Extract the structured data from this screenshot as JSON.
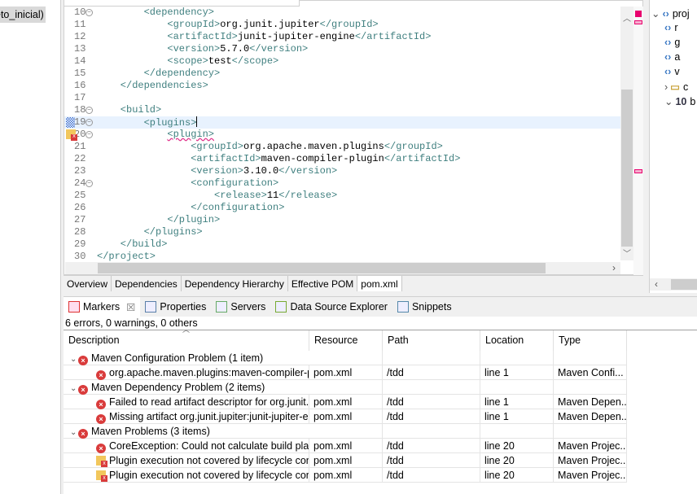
{
  "left_panel": {
    "selected_item": "eto_inicial)"
  },
  "editor": {
    "lines": [
      {
        "n": "10",
        "fold": true,
        "indent": 2,
        "parts": [
          [
            "tag",
            "<dependency>"
          ]
        ]
      },
      {
        "n": "11",
        "indent": 3,
        "parts": [
          [
            "tag",
            "<groupId>"
          ],
          [
            "txt",
            "org.junit.jupiter"
          ],
          [
            "tag",
            "</groupId>"
          ]
        ]
      },
      {
        "n": "12",
        "indent": 3,
        "parts": [
          [
            "tag",
            "<artifactId>"
          ],
          [
            "txt",
            "junit-jupiter-engine"
          ],
          [
            "tag",
            "</artifactId>"
          ]
        ]
      },
      {
        "n": "13",
        "indent": 3,
        "parts": [
          [
            "tag",
            "<version>"
          ],
          [
            "txt",
            "5.7.0"
          ],
          [
            "tag",
            "</version>"
          ]
        ]
      },
      {
        "n": "14",
        "indent": 3,
        "parts": [
          [
            "tag",
            "<scope>"
          ],
          [
            "txt",
            "test"
          ],
          [
            "tag",
            "</scope>"
          ]
        ]
      },
      {
        "n": "15",
        "indent": 2,
        "parts": [
          [
            "tag",
            "</dependency>"
          ]
        ]
      },
      {
        "n": "16",
        "indent": 1,
        "parts": [
          [
            "tag",
            "</dependencies>"
          ]
        ]
      },
      {
        "n": "17",
        "indent": 0,
        "parts": []
      },
      {
        "n": "18",
        "fold": true,
        "indent": 1,
        "parts": [
          [
            "tag",
            "<build>"
          ]
        ]
      },
      {
        "n": "19",
        "fold": true,
        "indent": 2,
        "current": true,
        "parts": [
          [
            "tag",
            "<plugins>"
          ]
        ]
      },
      {
        "n": "20",
        "fold": true,
        "indent": 3,
        "marker": "warning-error",
        "parts": [
          [
            "sq",
            "<plugin>"
          ]
        ]
      },
      {
        "n": "21",
        "indent": 4,
        "parts": [
          [
            "tag",
            "<groupId>"
          ],
          [
            "txt",
            "org.apache.maven.plugins"
          ],
          [
            "tag",
            "</groupId>"
          ]
        ]
      },
      {
        "n": "22",
        "indent": 4,
        "parts": [
          [
            "tag",
            "<artifactId>"
          ],
          [
            "txt",
            "maven-compiler-plugin"
          ],
          [
            "tag",
            "</artifactId>"
          ]
        ]
      },
      {
        "n": "23",
        "indent": 4,
        "parts": [
          [
            "tag",
            "<version>"
          ],
          [
            "txt",
            "3.10.0"
          ],
          [
            "tag",
            "</version>"
          ]
        ]
      },
      {
        "n": "24",
        "fold": true,
        "indent": 4,
        "parts": [
          [
            "tag",
            "<configuration>"
          ]
        ]
      },
      {
        "n": "25",
        "indent": 5,
        "parts": [
          [
            "tag",
            "<release>"
          ],
          [
            "txt",
            "11"
          ],
          [
            "tag",
            "</release>"
          ]
        ]
      },
      {
        "n": "26",
        "indent": 4,
        "parts": [
          [
            "tag",
            "</configuration>"
          ]
        ]
      },
      {
        "n": "27",
        "indent": 3,
        "parts": [
          [
            "tag",
            "</plugin>"
          ]
        ]
      },
      {
        "n": "28",
        "indent": 2,
        "parts": [
          [
            "tag",
            "</plugins>"
          ]
        ]
      },
      {
        "n": "29",
        "indent": 1,
        "parts": [
          [
            "tag",
            "</build>"
          ]
        ]
      },
      {
        "n": "30",
        "indent": 0,
        "parts": [
          [
            "tag",
            "</project>"
          ]
        ]
      }
    ],
    "tabs": [
      "Overview",
      "Dependencies",
      "Dependency Hierarchy",
      "Effective POM",
      "pom.xml"
    ],
    "active_tab": "pom.xml"
  },
  "outline": {
    "items": [
      "proj",
      "r",
      "g",
      "a",
      "v",
      "c",
      "b"
    ]
  },
  "markers": {
    "tabs": [
      {
        "label": "Markers",
        "icon": "markers-icon",
        "active": true
      },
      {
        "label": "Properties",
        "icon": "properties-icon"
      },
      {
        "label": "Servers",
        "icon": "servers-icon"
      },
      {
        "label": "Data Source Explorer",
        "icon": "data-source-icon"
      },
      {
        "label": "Snippets",
        "icon": "snippets-icon"
      }
    ],
    "close_glyph": "☒",
    "summary": "6 errors, 0 warnings, 0 others",
    "columns": [
      "Description",
      "Resource",
      "Path",
      "Location",
      "Type"
    ],
    "rows": [
      {
        "group": true,
        "desc": "Maven Configuration Problem (1 item)",
        "icon": "error"
      },
      {
        "desc": "org.apache.maven.plugins:maven-compiler-plugin",
        "icon": "error",
        "resource": "pom.xml",
        "path": "/tdd",
        "location": "line 1",
        "type": "Maven Confi..."
      },
      {
        "group": true,
        "desc": "Maven Dependency Problem (2 items)",
        "icon": "error"
      },
      {
        "desc": "Failed to read artifact descriptor for org.junit.jupiter",
        "icon": "error",
        "resource": "pom.xml",
        "path": "/tdd",
        "location": "line 1",
        "type": "Maven Depen..."
      },
      {
        "desc": "Missing artifact org.junit.jupiter:junit-jupiter-engine",
        "icon": "error",
        "resource": "pom.xml",
        "path": "/tdd",
        "location": "line 1",
        "type": "Maven Depen..."
      },
      {
        "group": true,
        "desc": "Maven Problems (3 items)",
        "icon": "error"
      },
      {
        "desc": "CoreException: Could not calculate build plan",
        "icon": "error",
        "resource": "pom.xml",
        "path": "/tdd",
        "location": "line 20",
        "type": "Maven Projec..."
      },
      {
        "desc": "Plugin execution not covered by lifecycle configuration",
        "icon": "warning-error",
        "resource": "pom.xml",
        "path": "/tdd",
        "location": "line 20",
        "type": "Maven Projec..."
      },
      {
        "desc": "Plugin execution not covered by lifecycle configuration",
        "icon": "warning-error",
        "resource": "pom.xml",
        "path": "/tdd",
        "location": "line 20",
        "type": "Maven Projec..."
      }
    ]
  }
}
